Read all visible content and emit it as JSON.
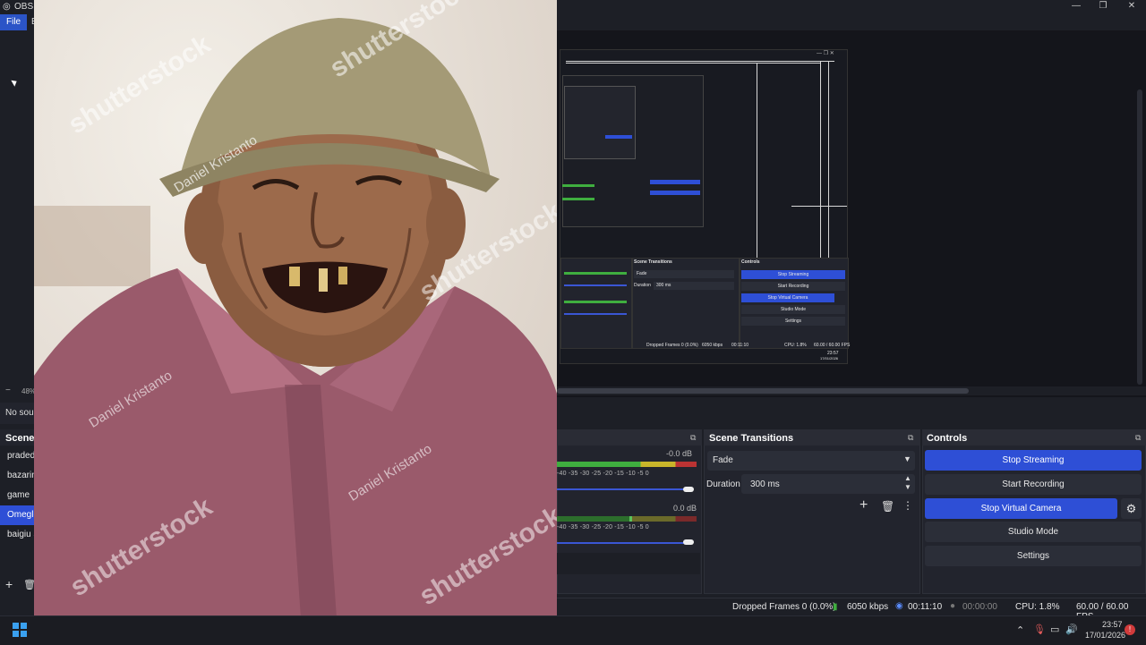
{
  "window": {
    "title": "OBS 3",
    "min": "—",
    "max": "❐",
    "close": "✕"
  },
  "menu": {
    "file": "File",
    "edit": "E"
  },
  "left": {
    "zoom": "48%",
    "no_source": "No sour",
    "scenes_title": "Scenes",
    "scenes": [
      "praded",
      "bazarin",
      "game",
      "Omegle",
      "baigiu s"
    ],
    "selected_index": 3
  },
  "nested_preview": {
    "scene_transitions": "Scene Transitions",
    "controls": "Controls",
    "fade": "Fade",
    "duration": "Duration",
    "duration_value": "300 ms",
    "stop_streaming": "Stop Streaming",
    "start_recording": "Start Recording",
    "stop_virtual_camera": "Stop Virtual Camera",
    "studio_mode": "Studio Mode",
    "settings": "Settings",
    "dropped": "Dropped Frames 0 (0.0%)",
    "kbps": "6050 kbps",
    "time": "00:11:10",
    "cpu": "CPU: 1.8%",
    "fps": "60.00 / 60.00 FPS",
    "clock": "23:57",
    "date": "17/01/2026"
  },
  "mixer": {
    "ch1_db": "-0.0 dB",
    "ch2_db": "0.0 dB",
    "scale": "-40 -35 -30 -25 -20 -15 -10 -5 0"
  },
  "transitions": {
    "title": "Scene Transitions",
    "selected": "Fade",
    "duration_label": "Duration",
    "duration_value": "300 ms"
  },
  "controls": {
    "title": "Controls",
    "stop_streaming": "Stop Streaming",
    "start_recording": "Start Recording",
    "stop_virtual_camera": "Stop Virtual Camera",
    "studio_mode": "Studio Mode",
    "settings": "Settings"
  },
  "status": {
    "dropped_frames": "Dropped Frames 0 (0.0%)",
    "bitrate": "6050 kbps",
    "stream_time": "00:11:10",
    "rec_time": "00:00:00",
    "cpu": "CPU: 1.8%",
    "fps": "60.00 / 60.00 FPS"
  },
  "taskbar": {
    "time": "23:57",
    "date": "17/01/2026"
  },
  "overlay": {
    "watermark": "shutterstock",
    "credit": "Daniel Kristanto"
  },
  "colors": {
    "accent": "#2e4fd6",
    "bg": "#1d1f26",
    "dock": "#22242d"
  }
}
